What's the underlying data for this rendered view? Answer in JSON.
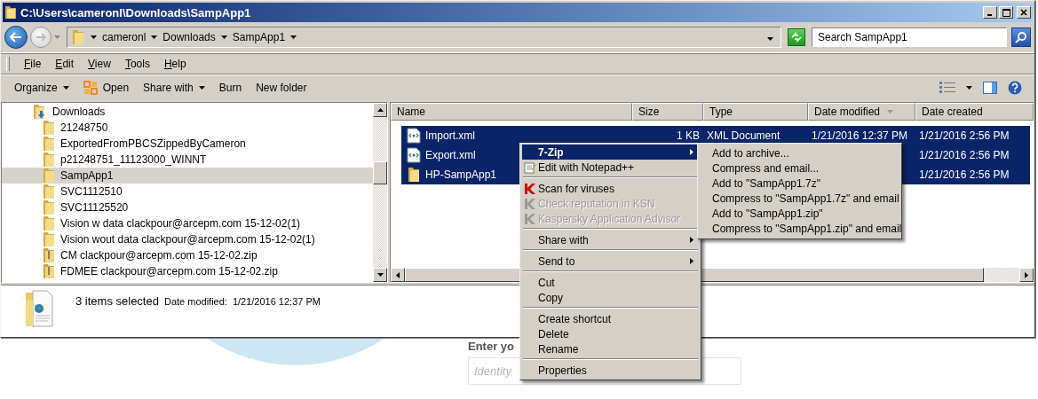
{
  "window": {
    "title": "C:\\Users\\cameronl\\Downloads\\SampApp1"
  },
  "address_bar": {
    "breadcrumbs": [
      "cameronl",
      "Downloads",
      "SampApp1"
    ],
    "search_placeholder": "Search SampApp1"
  },
  "menu_bar": [
    "File",
    "Edit",
    "View",
    "Tools",
    "Help"
  ],
  "toolbar": [
    {
      "label": "Organize",
      "kind": "dropdown"
    },
    {
      "label": "Open",
      "kind": "icon"
    },
    {
      "label": "Share with",
      "kind": "dropdown"
    },
    {
      "label": "Burn",
      "kind": "plain"
    },
    {
      "label": "New folder",
      "kind": "plain"
    }
  ],
  "nav_tree": [
    {
      "label": "Downloads",
      "kind": "downloads",
      "selected": false,
      "children": [
        {
          "label": "21248750",
          "kind": "folder",
          "selected": false
        },
        {
          "label": "ExportedFromPBCSZippedByCameron",
          "kind": "folder",
          "selected": false
        },
        {
          "label": "p21248751_11123000_WINNT",
          "kind": "folder",
          "selected": false
        },
        {
          "label": "SampApp1",
          "kind": "folder",
          "selected": true
        },
        {
          "label": "SVC1112510",
          "kind": "folder",
          "selected": false
        },
        {
          "label": "SVC11125520",
          "kind": "folder",
          "selected": false
        },
        {
          "label": "Vision w data clackpour@arcepm.com 15-12-02(1)",
          "kind": "folder",
          "selected": false
        },
        {
          "label": "Vision wout data clackpour@arcepm.com 15-12-02(1)",
          "kind": "folder",
          "selected": false
        },
        {
          "label": "CM clackpour@arcepm.com 15-12-02.zip",
          "kind": "zip",
          "selected": false
        },
        {
          "label": "FDMEE clackpour@arcepm.com 15-12-02.zip",
          "kind": "zip",
          "selected": false
        }
      ]
    }
  ],
  "file_list": {
    "columns": [
      {
        "label": "Name",
        "sorted": false
      },
      {
        "label": "Size",
        "sorted": false
      },
      {
        "label": "Type",
        "sorted": false
      },
      {
        "label": "Date modified",
        "sorted": true
      },
      {
        "label": "Date created",
        "sorted": false
      }
    ],
    "rows": [
      {
        "name": "Import.xml",
        "kind": "xml",
        "selected": true,
        "size": "1 KB",
        "type": "XML Document",
        "date_modified": "1/21/2016 12:37 PM",
        "date_created": "1/21/2016 2:56 PM"
      },
      {
        "name": "Export.xml",
        "kind": "xml",
        "selected": true,
        "date_created": "1/21/2016 2:56 PM"
      },
      {
        "name": "HP-SampApp1",
        "kind": "folder",
        "selected": true,
        "date_created": "1/21/2016 2:56 PM"
      }
    ]
  },
  "details_pane": {
    "summary": "3 items selected",
    "label": "Date modified:",
    "value": "1/21/2016 12:37 PM"
  },
  "context_menu": {
    "items": [
      {
        "kind": "item",
        "label": "7-Zip",
        "selected": true,
        "default": true,
        "disabled": false,
        "has_submenu": true,
        "submenu": [
          {
            "label": "Add to archive..."
          },
          {
            "label": "Compress and email..."
          },
          {
            "label": "Add to \"SampApp1.7z\""
          },
          {
            "label": "Compress to \"SampApp1.7z\" and email"
          },
          {
            "label": "Add to \"SampApp1.zip\""
          },
          {
            "label": "Compress to \"SampApp1.zip\" and email"
          }
        ]
      },
      {
        "kind": "notepad-item",
        "label": "Edit with Notepad++",
        "selected": false,
        "default": false,
        "disabled": false,
        "has_submenu": false
      },
      {
        "kind": "separator"
      },
      {
        "kind": "scanner-item",
        "label": "Scan for viruses",
        "selected": false,
        "default": false,
        "disabled": false,
        "has_submenu": false
      },
      {
        "kind": "scanner-item",
        "label": "Check reputation in KSN",
        "selected": false,
        "default": false,
        "disabled": true,
        "has_submenu": false
      },
      {
        "kind": "scanner-item",
        "label": "Kaspersky Application Advisor",
        "selected": false,
        "default": false,
        "disabled": true,
        "has_submenu": false
      },
      {
        "kind": "separator"
      },
      {
        "kind": "item",
        "label": "Share with",
        "selected": false,
        "default": false,
        "disabled": false,
        "has_submenu": true
      },
      {
        "kind": "separator"
      },
      {
        "kind": "item",
        "label": "Send to",
        "selected": false,
        "default": false,
        "disabled": false,
        "has_submenu": true
      },
      {
        "kind": "separator"
      },
      {
        "kind": "item",
        "label": "Cut",
        "selected": false,
        "default": false,
        "disabled": false,
        "has_submenu": false
      },
      {
        "kind": "item",
        "label": "Copy",
        "selected": false,
        "default": false,
        "disabled": false,
        "has_submenu": false
      },
      {
        "kind": "separator"
      },
      {
        "kind": "item",
        "label": "Create shortcut",
        "selected": false,
        "default": false,
        "disabled": false,
        "has_submenu": false
      },
      {
        "kind": "item",
        "label": "Delete",
        "selected": false,
        "default": false,
        "disabled": false,
        "has_submenu": false
      },
      {
        "kind": "item",
        "label": "Rename",
        "selected": false,
        "default": false,
        "disabled": false,
        "has_submenu": false
      },
      {
        "kind": "separator"
      },
      {
        "kind": "item",
        "label": "Properties",
        "selected": false,
        "default": false,
        "disabled": false,
        "has_submenu": false
      }
    ]
  },
  "background_page": {
    "heading": "Enter yo",
    "field_placeholder": "Identity"
  }
}
